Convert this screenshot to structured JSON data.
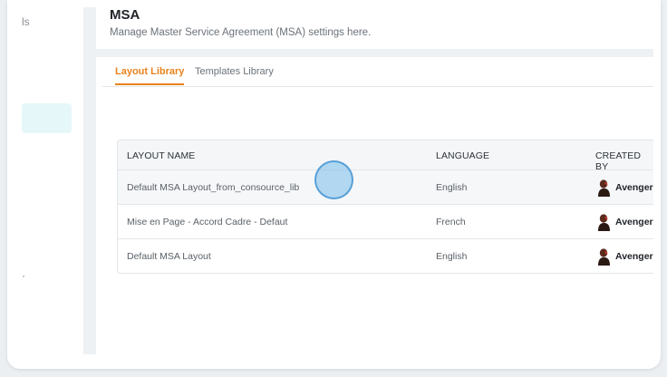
{
  "sidebar": {
    "top_label": "ls"
  },
  "header": {
    "title": "MSA",
    "subtitle": "Manage Master Service Agreement (MSA) settings here."
  },
  "tabs": [
    {
      "label": "Layout Library",
      "active": true
    },
    {
      "label": "Templates Library",
      "active": false
    }
  ],
  "table": {
    "columns": [
      "LAYOUT NAME",
      "LANGUAGE",
      "CREATED BY"
    ],
    "rows": [
      {
        "name": "Default MSA Layout_from_consource_lib",
        "language": "English",
        "created_by": "Avenger"
      },
      {
        "name": "Mise en Page - Accord Cadre - Defaut",
        "language": "French",
        "created_by": "Avenger"
      },
      {
        "name": "Default MSA Layout",
        "language": "English",
        "created_by": "Avenger"
      }
    ]
  },
  "colors": {
    "accent": "#e9821e",
    "sidebar_active": "#e6f7f9",
    "cursor": "#78beeb"
  },
  "icons": {
    "avatar": "user-avatar-icon"
  }
}
